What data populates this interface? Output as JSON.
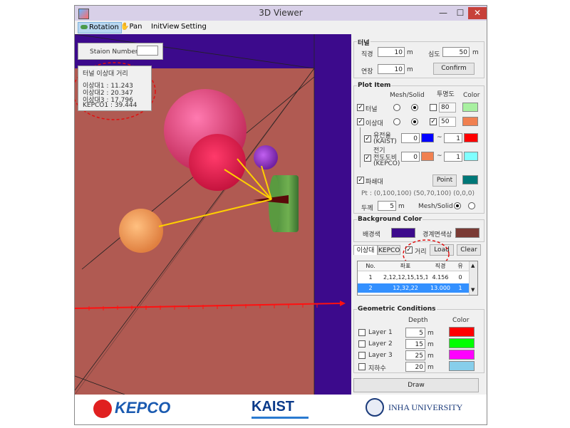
{
  "window": {
    "title": "3D Viewer",
    "minimize": "—",
    "maximize": "☐",
    "close": "✕"
  },
  "menu": {
    "rotation": "Rotation",
    "pan": "Pan",
    "initview": "InitView",
    "setting": "Setting"
  },
  "viewport": {
    "station_label": "Staion Number",
    "station_value": "",
    "info_title": "터널 이상대 거리",
    "lines": [
      "이상대1 : 11.243",
      "이상대2 : 20.347",
      "이상대3 : 17.796",
      "KEPCO1 : 39.444"
    ],
    "colors": {
      "background": "#b05a52",
      "boundary": "#3c0a8c"
    }
  },
  "tunnel": {
    "title": "터널",
    "diameter_label": "직경",
    "diameter_value": "10",
    "diameter_unit": "m",
    "depth_label": "심도",
    "depth_value": "50",
    "depth_unit": "m",
    "length_label": "연장",
    "length_value": "10",
    "length_unit": "m",
    "confirm": "Confirm"
  },
  "plot_item": {
    "title": "Plot Item",
    "mesh_header": "Mesh/Solid",
    "transparency_header": "투명도",
    "color_header": "Color",
    "tunnel_label": "터널",
    "tunnel_transparency": "80",
    "anomaly_label": "이상대",
    "anomaly_transparency": "50",
    "resistivity_label": "유전율",
    "resistivity_sub": "(KAIST)",
    "resistivity_min": "0",
    "resistivity_max": "1",
    "range_sep": "~",
    "conductivity_label": "전기",
    "conductivity_label2": "전도도비",
    "conductivity_sub": "(KEPCO)",
    "conductivity_min": "0",
    "conductivity_max": "1",
    "fracture_label": "파쇄대",
    "point_button": "Point",
    "pt_text": "Pt : (0,100,100) (50,70,100) (0,0,0)",
    "thickness_label": "두께",
    "thickness_value": "5",
    "thickness_unit": "m",
    "mesh_solid_label": "Mesh/Solid",
    "colors": {
      "tunnel": "#a8f0a0",
      "anomaly": "#f08050",
      "kaist_min": "#0000ff",
      "kaist_max": "#ff0000",
      "kepco_min": "#f08050",
      "kepco_max": "#80ffff",
      "fracture": "#007878"
    }
  },
  "background_color": {
    "title": "Background Color",
    "bg_label": "배경색",
    "boundary_label": "경계면색상",
    "colors": {
      "bg": "#3c0a8c",
      "boundary": "#7a3a34"
    }
  },
  "tabs": {
    "anomaly": "이상대",
    "kepco": "KEPCO",
    "distance": "거리",
    "load": "Load",
    "clear": "Clear"
  },
  "grid": {
    "headers": [
      "No.",
      "좌표",
      "직경",
      "유"
    ],
    "rows": [
      [
        "1",
        "2,12,12,15,15,1",
        "4.156",
        "0"
      ],
      [
        "2",
        "12,32,22",
        "13.000",
        "1"
      ]
    ]
  },
  "geometric": {
    "title": "Geometric Conditions",
    "depth_header": "Depth",
    "color_header": "Color",
    "layers": [
      {
        "label": "Layer 1",
        "depth": "5",
        "unit": "m",
        "color": "#ff0000"
      },
      {
        "label": "Layer 2",
        "depth": "15",
        "unit": "m",
        "color": "#00ff00"
      },
      {
        "label": "Layer 3",
        "depth": "25",
        "unit": "m",
        "color": "#ff00ff"
      },
      {
        "label": "지하수",
        "depth": "20",
        "unit": "m",
        "color": "#87ceeb"
      }
    ]
  },
  "draw_button": "Draw",
  "logos": {
    "kepco": "KEPCO",
    "kaist": "KAIST",
    "inha": "INHA UNIVERSITY"
  }
}
